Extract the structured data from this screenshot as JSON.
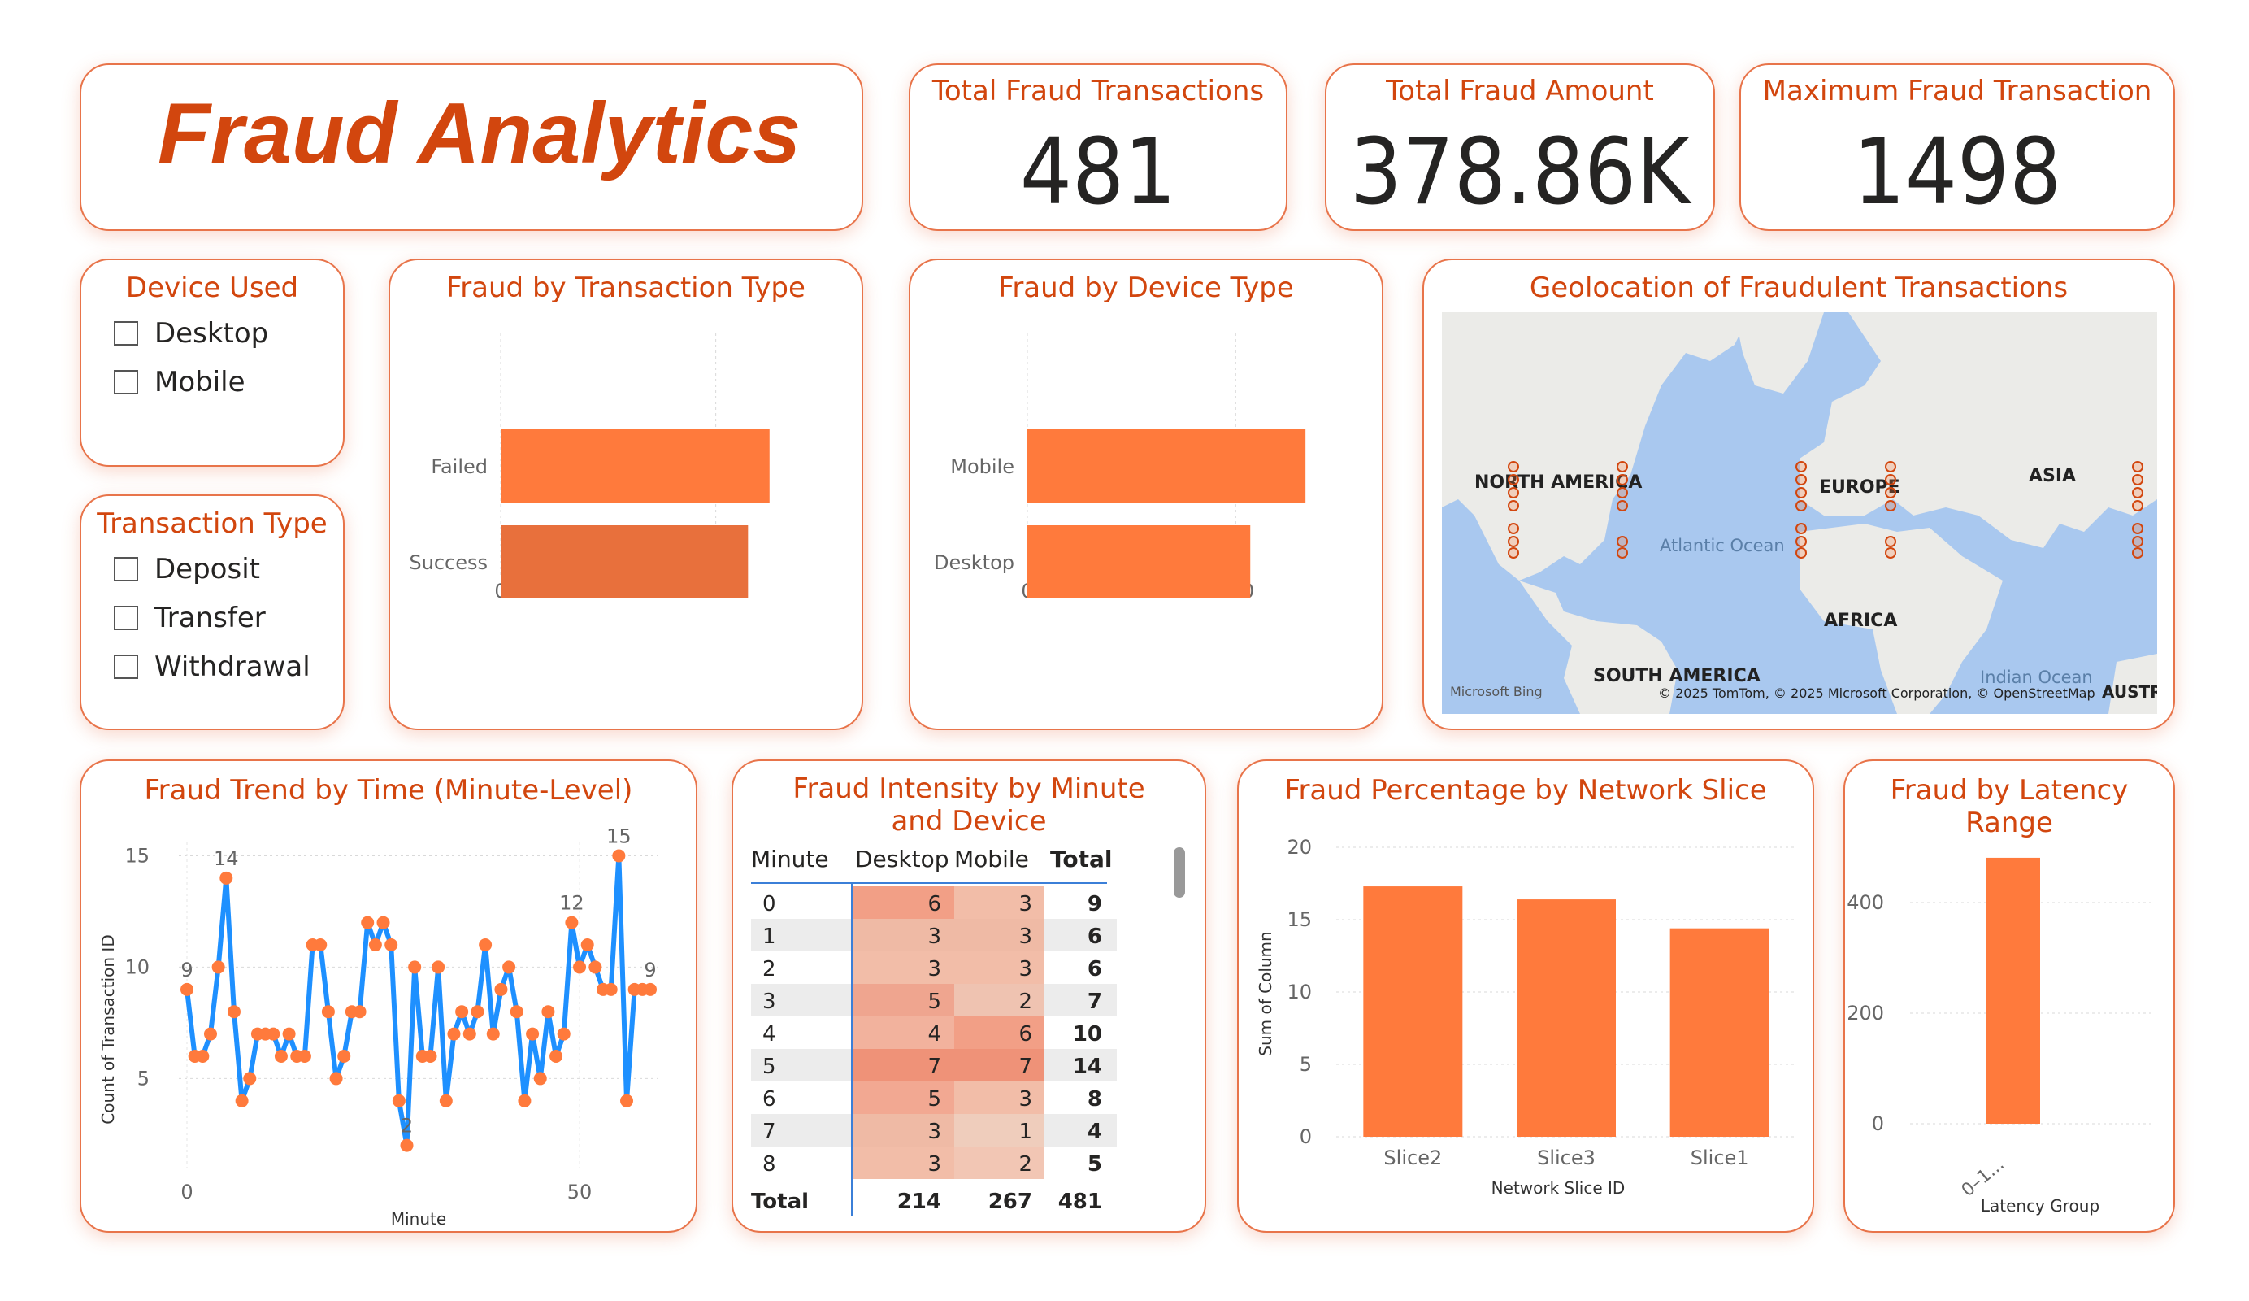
{
  "header": {
    "title": "Fraud Analytics"
  },
  "kpis": [
    {
      "label": "Total Fraud Transactions",
      "value": "481"
    },
    {
      "label": "Total Fraud Amount",
      "value": "378.86K"
    },
    {
      "label": "Maximum Fraud Transaction",
      "value": "1498"
    }
  ],
  "slicers": {
    "device": {
      "title": "Device Used",
      "options": [
        "Desktop",
        "Mobile"
      ]
    },
    "transaction": {
      "title": "Transaction Type",
      "options": [
        "Deposit",
        "Transfer",
        "Withdrawal"
      ]
    }
  },
  "colors": {
    "accent": "#d2460e",
    "bar": "#ff7a3c",
    "bar_dark": "#e8703c",
    "line": "#1e90ff",
    "dot": "#ff7a3c",
    "card_border": "#e8744a"
  },
  "map": {
    "title": "Geolocation of Fraudulent Transactions",
    "labels": [
      "NORTH AMERICA",
      "EUROPE",
      "ASIA",
      "Atlantic Ocean",
      "AFRICA",
      "SOUTH AMERICA",
      "Indian Ocean",
      "AUSTRA"
    ],
    "attribution": "© 2025 TomTom, © 2025 Microsoft Corporation, © OpenStreetMap",
    "logo": "Microsoft Bing"
  },
  "chart_data": [
    {
      "id": "fraud_by_transaction_type",
      "type": "bar",
      "orientation": "horizontal",
      "title": "Fraud by Transaction Type",
      "categories": [
        "Failed",
        "Success"
      ],
      "values": [
        250,
        230
      ],
      "xlim": [
        0,
        260
      ],
      "xticks": [
        0,
        200
      ],
      "grid": true
    },
    {
      "id": "fraud_by_device_type",
      "type": "bar",
      "orientation": "horizontal",
      "title": "Fraud by Device Type",
      "categories": [
        "Mobile",
        "Desktop"
      ],
      "values": [
        267,
        214
      ],
      "xlim": [
        0,
        270
      ],
      "xticks": [
        0,
        200
      ],
      "grid": true
    },
    {
      "id": "fraud_trend_by_minute",
      "type": "line",
      "title": "Fraud Trend by Time (Minute-Level)",
      "xlabel": "Minute",
      "ylabel": "Count of Transaction ID",
      "xlim": [
        0,
        59
      ],
      "ylim": [
        2,
        15
      ],
      "xticks": [
        0,
        50
      ],
      "yticks": [
        5,
        10,
        15
      ],
      "x": [
        0,
        1,
        2,
        3,
        4,
        5,
        6,
        7,
        8,
        9,
        10,
        11,
        12,
        13,
        14,
        15,
        16,
        17,
        18,
        19,
        20,
        21,
        22,
        23,
        24,
        25,
        26,
        27,
        28,
        29,
        30,
        31,
        32,
        33,
        34,
        35,
        36,
        37,
        38,
        39,
        40,
        41,
        42,
        43,
        44,
        45,
        46,
        47,
        48,
        49,
        50,
        51,
        52,
        53,
        54,
        55,
        56,
        57,
        58,
        59
      ],
      "values": [
        9,
        6,
        6,
        7,
        10,
        14,
        8,
        4,
        5,
        7,
        7,
        7,
        6,
        7,
        6,
        6,
        11,
        11,
        8,
        5,
        6,
        8,
        8,
        12,
        11,
        12,
        11,
        4,
        2,
        10,
        6,
        6,
        10,
        4,
        7,
        8,
        7,
        8,
        11,
        7,
        9,
        10,
        8,
        4,
        7,
        5,
        8,
        6,
        7,
        12,
        10,
        11,
        10,
        9,
        9,
        15,
        4,
        9,
        9,
        9
      ],
      "point_labels": [
        {
          "x": 0,
          "text": "9"
        },
        {
          "x": 5,
          "text": "14"
        },
        {
          "x": 28,
          "text": "2"
        },
        {
          "x": 49,
          "text": "12"
        },
        {
          "x": 55,
          "text": "15"
        },
        {
          "x": 59,
          "text": "9"
        }
      ],
      "grid": true
    },
    {
      "id": "fraud_intensity_table",
      "type": "table",
      "title": "Fraud Intensity by Minute and Device",
      "columns": [
        "Minute",
        "Desktop",
        "Mobile",
        "Total"
      ],
      "rows": [
        [
          "0",
          "6",
          "3",
          "9"
        ],
        [
          "1",
          "3",
          "3",
          "6"
        ],
        [
          "2",
          "3",
          "3",
          "6"
        ],
        [
          "3",
          "5",
          "2",
          "7"
        ],
        [
          "4",
          "4",
          "6",
          "10"
        ],
        [
          "5",
          "7",
          "7",
          "14"
        ],
        [
          "6",
          "5",
          "3",
          "8"
        ],
        [
          "7",
          "3",
          "1",
          "4"
        ],
        [
          "8",
          "3",
          "2",
          "5"
        ]
      ],
      "total": [
        "Total",
        "214",
        "267",
        "481"
      ]
    },
    {
      "id": "fraud_pct_by_network_slice",
      "type": "bar",
      "title": "Fraud Percentage by Network Slice",
      "xlabel": "Network Slice ID",
      "ylabel": "Sum of Column",
      "categories": [
        "Slice2",
        "Slice3",
        "Slice1"
      ],
      "values": [
        17.3,
        16.4,
        14.4
      ],
      "ylim": [
        0,
        20
      ],
      "yticks": [
        0,
        5,
        10,
        15,
        20
      ],
      "grid": true
    },
    {
      "id": "fraud_by_latency_range",
      "type": "bar",
      "title": "Fraud by Latency Range",
      "xlabel": "Latency Group",
      "ylabel": "",
      "categories": [
        "0–1..."
      ],
      "values": [
        481
      ],
      "ylim": [
        0,
        500
      ],
      "yticks": [
        0,
        200,
        400
      ],
      "grid": true
    }
  ]
}
